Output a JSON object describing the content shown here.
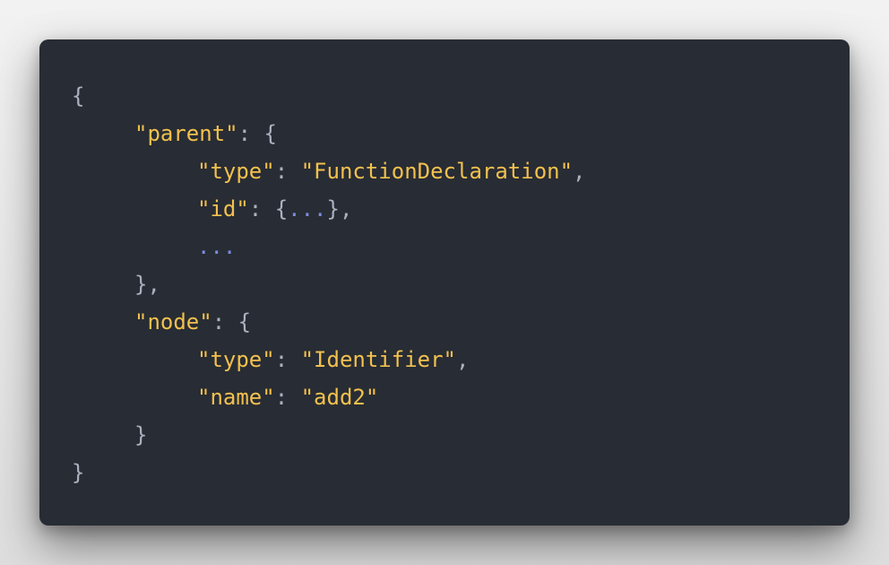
{
  "code": {
    "open_root": "{",
    "parent_key": "\"parent\"",
    "parent_open": ": {",
    "type_key": "\"type\"",
    "type_value": "\"FunctionDeclaration\"",
    "id_key": "\"id\"",
    "id_open": ": {",
    "id_ellipsis": "...",
    "id_close": "},",
    "ellipsis_line": "...",
    "parent_close": "},",
    "node_key": "\"node\"",
    "node_open": ": {",
    "node_type_key": "\"type\"",
    "node_type_value": "\"Identifier\"",
    "name_key": "\"name\"",
    "name_value": "\"add2\"",
    "node_close": "}",
    "close_root": "}"
  },
  "colors": {
    "background": "#282c34",
    "key_string": "#f2c14e",
    "punctuation": "#abb2bf",
    "ellipsis": "#7c8cde"
  }
}
